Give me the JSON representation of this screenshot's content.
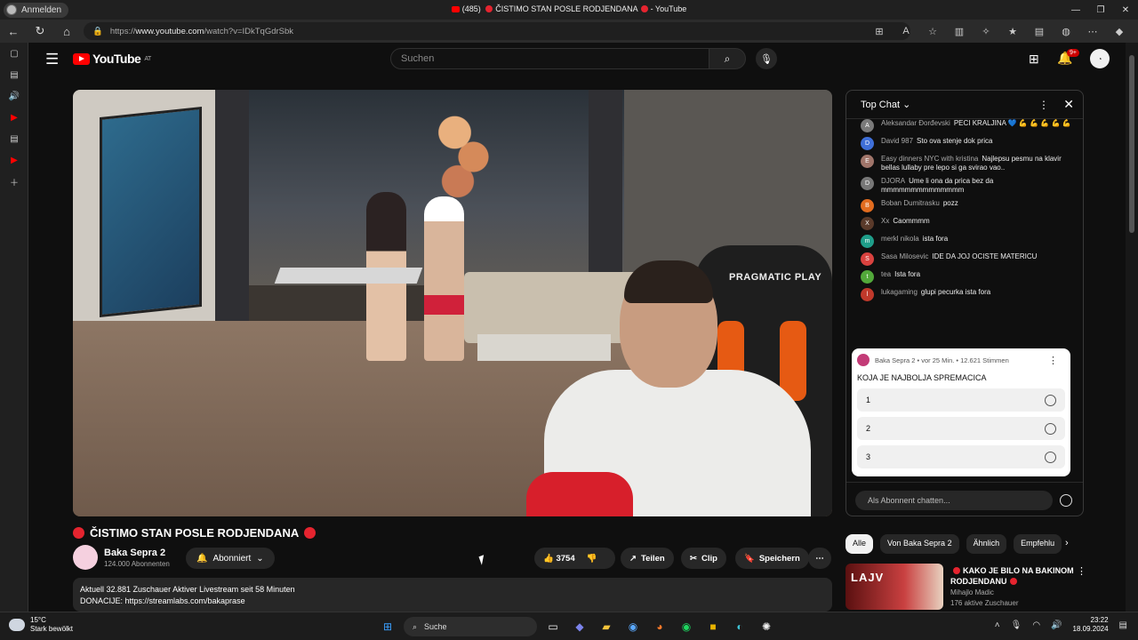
{
  "browser": {
    "profile_label": "Anmelden",
    "tab_title_prefix": "(485)",
    "tab_title_main": "ČISTIMO STAN POSLE RODJENDANA",
    "tab_title_suffix": "- YouTube",
    "url_prefix": "https://",
    "url_host": "www.youtube.com",
    "url_path": "/watch?v=IDkTqGdrSbk"
  },
  "header": {
    "logo_text": "YouTube",
    "logo_country": "AT",
    "search_placeholder": "Suchen",
    "notification_count": "9+"
  },
  "video": {
    "title": "ČISTIMO STAN POSLE RODJENDANA",
    "chair_brand": "PRAGMATIC PLAY",
    "channel_name": "Baka Sepra 2",
    "channel_subs": "124.000 Abonnenten",
    "subscribe_label": "Abonniert",
    "likes": "3754",
    "share_label": "Teilen",
    "clip_label": "Clip",
    "save_label": "Speichern",
    "desc_line1": "Aktuell 32.881 Zuschauer  Aktiver Livestream seit 58 Minuten",
    "desc_line2": "DONACIJE: https://streamlabs.com/bakaprase"
  },
  "chat": {
    "header": "Top Chat",
    "messages": [
      {
        "author": "Aleksandar Đorđevski",
        "text": "PECI KRALJINA 💙 💪 💪 💪 💪 💪",
        "initial": "A",
        "color": "#7a7a7a"
      },
      {
        "author": "David 987",
        "text": "Sto ova stenje dok prica",
        "initial": "D",
        "color": "#3f6fd8"
      },
      {
        "author": "Easy dinners NYC with kristina",
        "text": "Najlepsu pesmu na klavir bellas lullaby pre lepo si ga svirao vao..",
        "initial": "E",
        "color": "#a0756a"
      },
      {
        "author": "DJORA",
        "text": "Ume li ona da prica bez da mmmmmmmmmmmmmm",
        "initial": "D",
        "color": "#777777"
      },
      {
        "author": "Boban Dumitrasku",
        "text": "pozz",
        "initial": "B",
        "color": "#e26c1f"
      },
      {
        "author": "Xx",
        "text": "Caommmm",
        "initial": "X",
        "color": "#5a3a2a"
      },
      {
        "author": "merkl nikola",
        "text": "ista fora",
        "initial": "m",
        "color": "#1f9e8a"
      },
      {
        "author": "Sasa Milosevic",
        "text": "IDE DA JOJ OCISTE MATERICU",
        "initial": "S",
        "color": "#d9423f"
      },
      {
        "author": "tea",
        "text": "Ista fora",
        "initial": "t",
        "color": "#52a83a"
      },
      {
        "author": "lukagaming",
        "text": "glupi pecurka ista fora",
        "initial": "l",
        "color": "#c0392b"
      }
    ],
    "poll": {
      "meta": "Baka Sepra 2 • vor 25 Min. • 12.621 Stimmen",
      "question": "KOJA JE NAJBOLJA SPREMACICA",
      "options": [
        "1",
        "2",
        "3"
      ]
    },
    "input_placeholder": "Als Abonnent chatten..."
  },
  "sidebar_right": {
    "chips": [
      "Alle",
      "Von Baka Sepra 2",
      "Ähnlich",
      "Empfehlu"
    ],
    "rec": {
      "thumb_text": "LAJV",
      "title": "KAKO JE BILO NA BAKINOM RODJENDANU",
      "channel": "Mihajlo Madic",
      "views": "176 aktive Zuschauer"
    }
  },
  "taskbar": {
    "temperature": "15°C",
    "weather": "Stark bewölkt",
    "search_label": "Suche",
    "time": "23:22",
    "date": "18.09.2024"
  }
}
